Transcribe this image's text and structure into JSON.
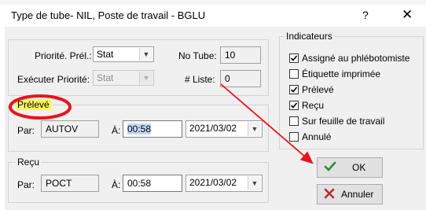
{
  "window": {
    "title": "Type de tube- NIL, Poste de travail - BGLU",
    "help_glyph": "?",
    "close_glyph": "✕"
  },
  "form": {
    "priorite_label": "Priorité. Prél.:",
    "priorite_value": "Stat",
    "executer_label": "Exécuter Priorité:",
    "executer_value": "Stat",
    "no_tube_label": "No Tube:",
    "no_tube_value": "10",
    "liste_label": "# Liste:",
    "liste_value": "0"
  },
  "preleve": {
    "legend": "Prélevé",
    "par_label": "Par:",
    "par_value": "AUTOV",
    "a_label": "À:",
    "time_value": "00:58",
    "date_value": "2021/03/02"
  },
  "recu": {
    "legend": "Reçu",
    "par_label": "Par:",
    "par_value": "POCT",
    "a_label": "À:",
    "time_value": "00:58",
    "date_value": "2021/03/02"
  },
  "indicateurs": {
    "legend": "Indicateurs",
    "items": [
      {
        "label": "Assigné au phlébotomiste",
        "checked": true
      },
      {
        "label": "Étiquette imprimée",
        "checked": false
      },
      {
        "label": "Prélevé",
        "checked": true
      },
      {
        "label": "Reçu",
        "checked": true
      },
      {
        "label": "Sur feuille de travail",
        "checked": false
      },
      {
        "label": "Annulé",
        "checked": false
      }
    ]
  },
  "buttons": {
    "ok_label": "OK",
    "annuler_label": "Annuler"
  },
  "colors": {
    "annotation_red": "#e8141c",
    "highlight_yellow": "#f8f85a",
    "selection_blue": "#c6d8f2",
    "ok_check_green": "#2e8b3c",
    "cancel_x_red": "#c4262e"
  }
}
